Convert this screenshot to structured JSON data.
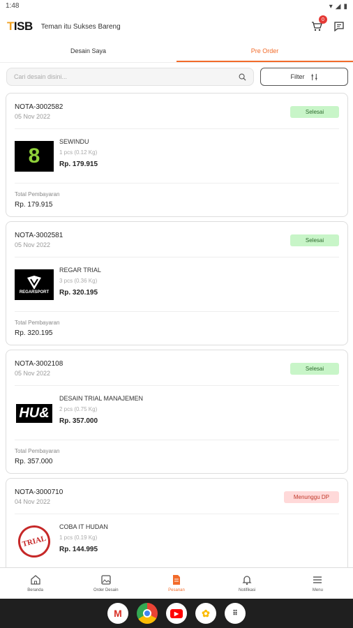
{
  "status_bar": {
    "time": "1:48"
  },
  "header": {
    "logo_left": "T",
    "logo_right": "ISB",
    "tagline": "Teman itu Sukses Bareng",
    "cart_count": "0"
  },
  "tabs": [
    {
      "label": "Desain Saya"
    },
    {
      "label": "Pre Order"
    }
  ],
  "search": {
    "placeholder": "Cari desain disini...",
    "filter_label": "Filter"
  },
  "orders": [
    {
      "nota": "NOTA-3002582",
      "date": "05 Nov 2022",
      "status": "Selesai",
      "product": "SEWINDU",
      "qty": "1 pcs (0.12 Kg)",
      "price": "Rp. 179.915",
      "total_label": "Total Pembayaran",
      "total": "Rp. 179.915",
      "thumb_text": "8"
    },
    {
      "nota": "NOTA-3002581",
      "date": "05 Nov 2022",
      "status": "Selesai",
      "product": "REGAR TRIAL",
      "qty": "3 pcs (0.36 Kg)",
      "price": "Rp. 320.195",
      "total_label": "Total Pembayaran",
      "total": "Rp. 320.195",
      "thumb_text": "REGARSPORT"
    },
    {
      "nota": "NOTA-3002108",
      "date": "05 Nov 2022",
      "status": "Selesai",
      "product": "DESAIN TRIAL MANAJEMEN",
      "qty": "2 pcs (0.75 Kg)",
      "price": "Rp. 357.000",
      "total_label": "Total Pembayaran",
      "total": "Rp. 357.000",
      "thumb_text": "HU&"
    },
    {
      "nota": "NOTA-3000710",
      "date": "04 Nov 2022",
      "status": "Menunggu DP",
      "product": "COBA IT HUDAN",
      "qty": "1 pcs (0.19 Kg)",
      "price": "Rp. 144.995",
      "total_label": "",
      "total": "",
      "thumb_text": "TRIAL"
    }
  ],
  "bottom_nav": [
    {
      "label": "Beranda",
      "icon": "home-icon"
    },
    {
      "label": "Order Desain",
      "icon": "image-icon"
    },
    {
      "label": "Pesanan",
      "icon": "document-icon"
    },
    {
      "label": "Notifikasi",
      "icon": "bell-icon"
    },
    {
      "label": "Menu",
      "icon": "menu-icon"
    }
  ],
  "colors": {
    "accent": "#f26b2a",
    "done_bg": "#c8f5c8",
    "wait_bg": "#ffd9d9"
  }
}
